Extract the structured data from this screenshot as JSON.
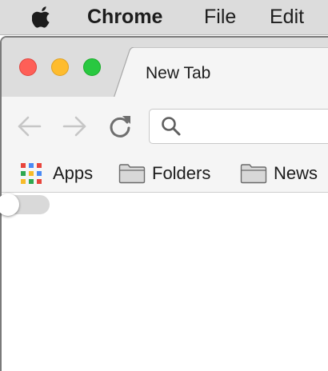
{
  "menubar": {
    "app_name": "Chrome",
    "items": [
      "File",
      "Edit"
    ],
    "apple_icon": "apple-icon"
  },
  "window": {
    "traffic_lights": {
      "close_color": "#fe5f57",
      "minimize_color": "#febc2e",
      "maximize_color": "#28c840"
    },
    "tabs": [
      {
        "title": "New Tab",
        "active": true
      }
    ]
  },
  "toolbar": {
    "back_icon": "arrow-left-icon",
    "forward_icon": "arrow-right-icon",
    "reload_icon": "reload-icon",
    "omnibox": {
      "icon": "search-icon",
      "value": "",
      "placeholder": ""
    }
  },
  "bookmarks": [
    {
      "label": "Apps",
      "icon": "apps-grid-icon"
    },
    {
      "label": "Folders",
      "icon": "folder-icon"
    },
    {
      "label": "News",
      "icon": "folder-icon"
    }
  ],
  "toggle": {
    "state": "off"
  }
}
